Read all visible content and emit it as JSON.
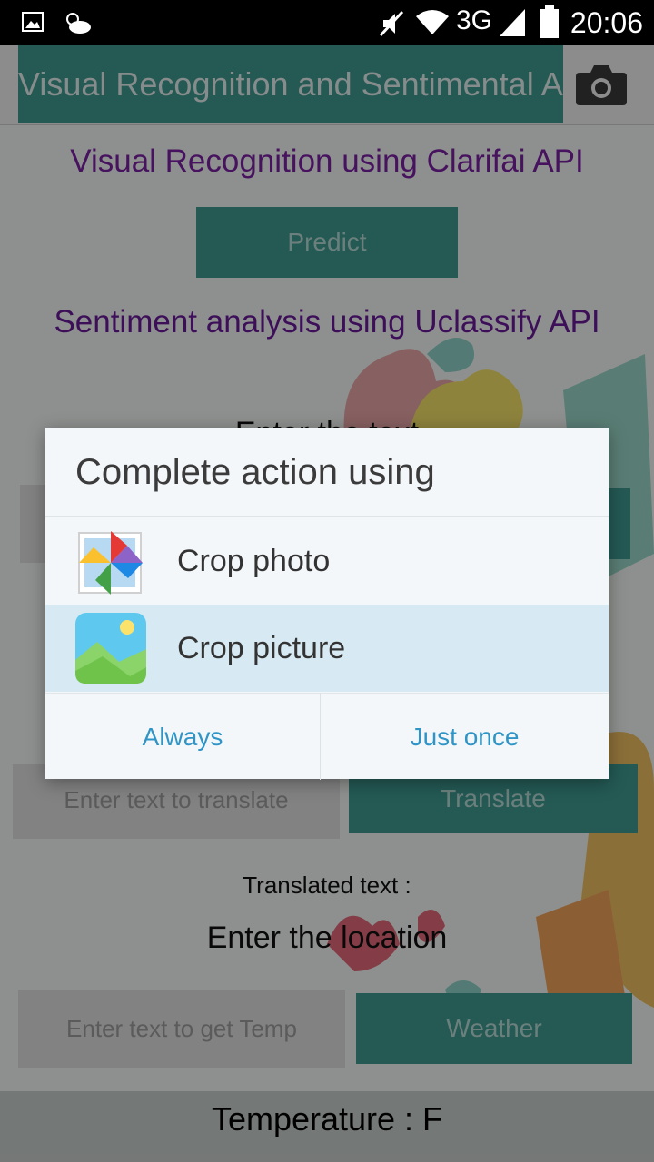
{
  "status_bar": {
    "network": "3G",
    "time": "20:06",
    "icons": [
      "image-icon",
      "weather-icon",
      "mute-icon",
      "wifi-icon",
      "signal-icon",
      "battery-icon"
    ]
  },
  "app": {
    "title": "Visual Recognition and Sentimental Analysis",
    "clarifai_heading": "Visual Recognition using Clarifai API",
    "predict_label": "Predict",
    "uclassify_heading": "Sentiment analysis using Uclassify API",
    "enter_text_label": "Enter the text",
    "translate_input_placeholder": "Enter text to translate",
    "translate_label": "Translate",
    "translated_text_label": "Translated text :",
    "location_label": "Enter the location",
    "temp_input_placeholder": "Enter text to get Temp",
    "weather_label": "Weather",
    "temperature_label": "Temperature : F"
  },
  "dialog": {
    "title": "Complete action using",
    "options": [
      {
        "label": "Crop photo",
        "icon": "photos-pinwheel-icon",
        "selected": false
      },
      {
        "label": "Crop picture",
        "icon": "gallery-picture-icon",
        "selected": true
      }
    ],
    "always_label": "Always",
    "just_once_label": "Just once"
  },
  "colors": {
    "accent_teal": "#3f9a92",
    "heading_purple": "#7a1fa2",
    "dialog_action_blue": "#2f94c6",
    "selected_row": "#d7e9f2"
  }
}
